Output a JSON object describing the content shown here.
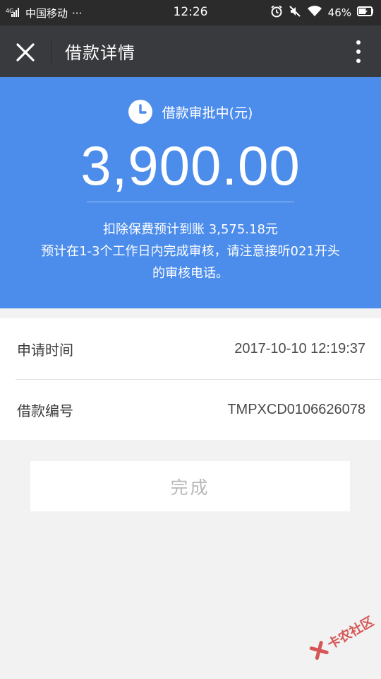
{
  "status_bar": {
    "carrier": "中国移动",
    "dots": "···",
    "time": "12:26",
    "battery": "46%"
  },
  "app_bar": {
    "title": "借款详情"
  },
  "summary": {
    "status_text": "借款审批中(元)",
    "amount": "3,900.00",
    "note_line1": "扣除保费预计到账 3,575.18元",
    "note_line2": "预计在1-3个工作日内完成审核，请注意接听021开头",
    "note_line3": "的审核电话。"
  },
  "details": [
    {
      "label": "申请时间",
      "value": "2017-10-10 12:19:37"
    },
    {
      "label": "借款编号",
      "value": "TMPXCD0106626078"
    }
  ],
  "done_label": "完成",
  "watermark_text": "卡农社区",
  "colors": {
    "primary_blue": "#4c8ceb",
    "app_bar": "#393a3e",
    "status_bar": "#2b2b2b"
  }
}
